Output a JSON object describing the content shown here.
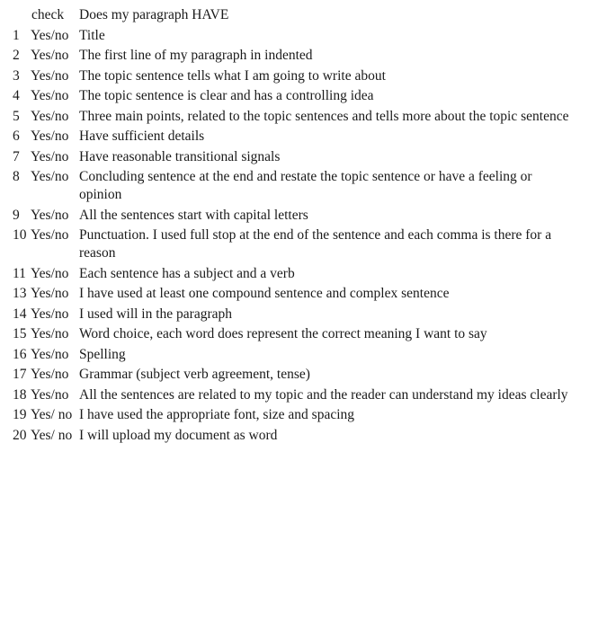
{
  "header": {
    "check_label": "check",
    "question": "Does my paragraph HAVE"
  },
  "items": [
    {
      "num": "1",
      "check": "Yes/no",
      "text": "Title"
    },
    {
      "num": "2",
      "check": "Yes/no",
      "text": "The first line of my paragraph in indented"
    },
    {
      "num": "3",
      "check": "Yes/no",
      "text": "The topic sentence tells what I am going to write about"
    },
    {
      "num": "4",
      "check": "Yes/no",
      "text": "The topic sentence is clear and has a controlling idea"
    },
    {
      "num": "5",
      "check": "Yes/no",
      "text": "Three main points, related to the topic sentences and tells more about the topic sentence"
    },
    {
      "num": "6",
      "check": "Yes/no",
      "text": "Have sufficient details"
    },
    {
      "num": "7",
      "check": "Yes/no",
      "text": "Have reasonable transitional signals"
    },
    {
      "num": "8",
      "check": "Yes/no",
      "text": "Concluding sentence at the end and restate the topic sentence or have a feeling or opinion"
    },
    {
      "num": "9",
      "check": "Yes/no",
      "text": "All the sentences start with capital letters"
    },
    {
      "num": "10",
      "check": "Yes/no",
      "text": "Punctuation. I used full stop at the end of the sentence and each comma is there for a reason"
    },
    {
      "num": "11",
      "check": "Yes/no",
      "text": "Each sentence has a subject and a verb"
    },
    {
      "num": "13",
      "check": "Yes/no",
      "text": "I have used at least one compound sentence and complex sentence"
    },
    {
      "num": "14",
      "check": "Yes/no",
      "text": "I used will in the paragraph"
    },
    {
      "num": "15",
      "check": "Yes/no",
      "text": "Word choice, each word does represent the correct meaning I want to say"
    },
    {
      "num": "16",
      "check": "Yes/no",
      "text": "Spelling"
    },
    {
      "num": "17",
      "check": "Yes/no",
      "text": "Grammar (subject verb agreement, tense)"
    },
    {
      "num": "18",
      "check": "Yes/no",
      "text": "All the sentences are related to my topic and the reader can understand my ideas clearly"
    },
    {
      "num": "19",
      "check": "Yes/ no",
      "text": "I have used the appropriate font, size and spacing"
    },
    {
      "num": "20",
      "check": "Yes/ no",
      "text": "I will upload my document as word"
    }
  ]
}
